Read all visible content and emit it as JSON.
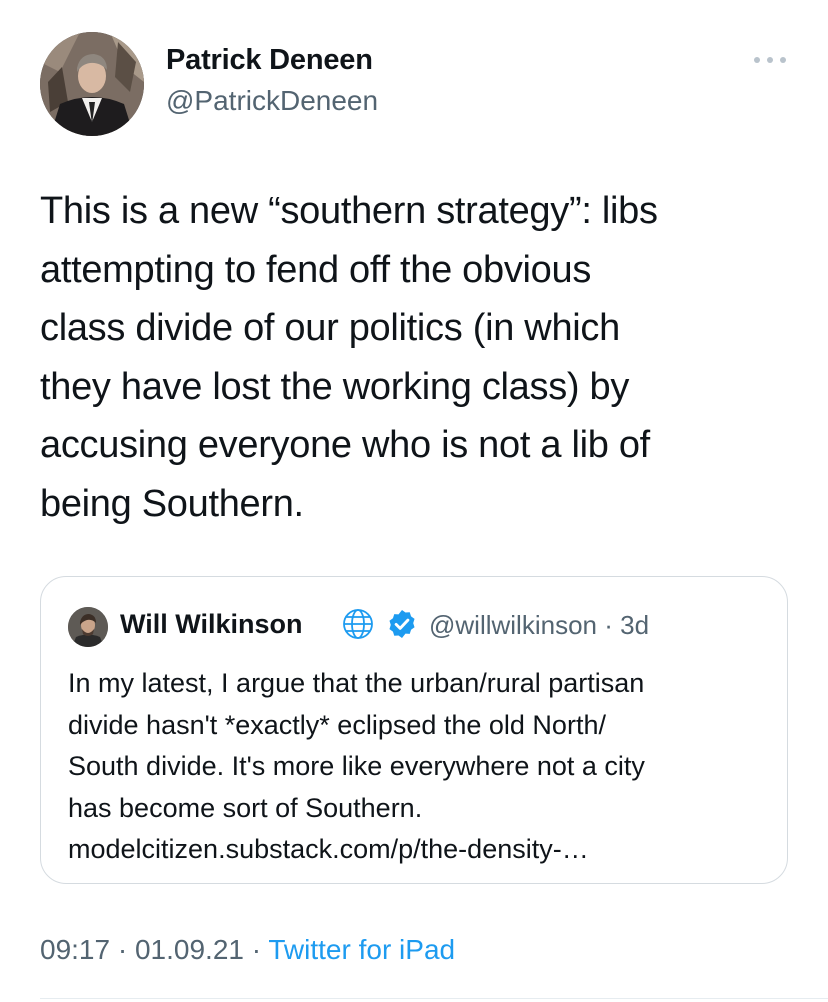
{
  "author": {
    "name": "Patrick Deneen",
    "handle": "@PatrickDeneen",
    "avatar_icon": "user-photo"
  },
  "more_icon": "more-horizontal-icon",
  "tweet": {
    "lines": [
      "This is a new “southern strategy”: libs",
      "attempting to fend off the obvious",
      "class divide of our politics (in which",
      "they have lost the working class) by",
      "accusing everyone who is not a lib of",
      "being Southern."
    ]
  },
  "quote": {
    "name": "Will Wilkinson",
    "handle": "@willwilkinson",
    "separator": "·",
    "age": "3d",
    "icons": [
      "globe-icon",
      "verified-badge-icon"
    ],
    "lines": [
      "In my latest, I argue that the urban/rural partisan",
      "divide hasn't *exactly* eclipsed the old North/",
      "South divide. It's more like everywhere not a city",
      "has become sort of Southern.",
      "modelcitizen.substack.com/p/the-density-…"
    ]
  },
  "footer": {
    "time": "09:17",
    "date": "01.09.21",
    "separator": "·",
    "source": "Twitter for iPad"
  },
  "colors": {
    "text": "#0f1419",
    "secondary": "#536471",
    "link": "#1d9bf0",
    "border": "#d5dbe0"
  }
}
